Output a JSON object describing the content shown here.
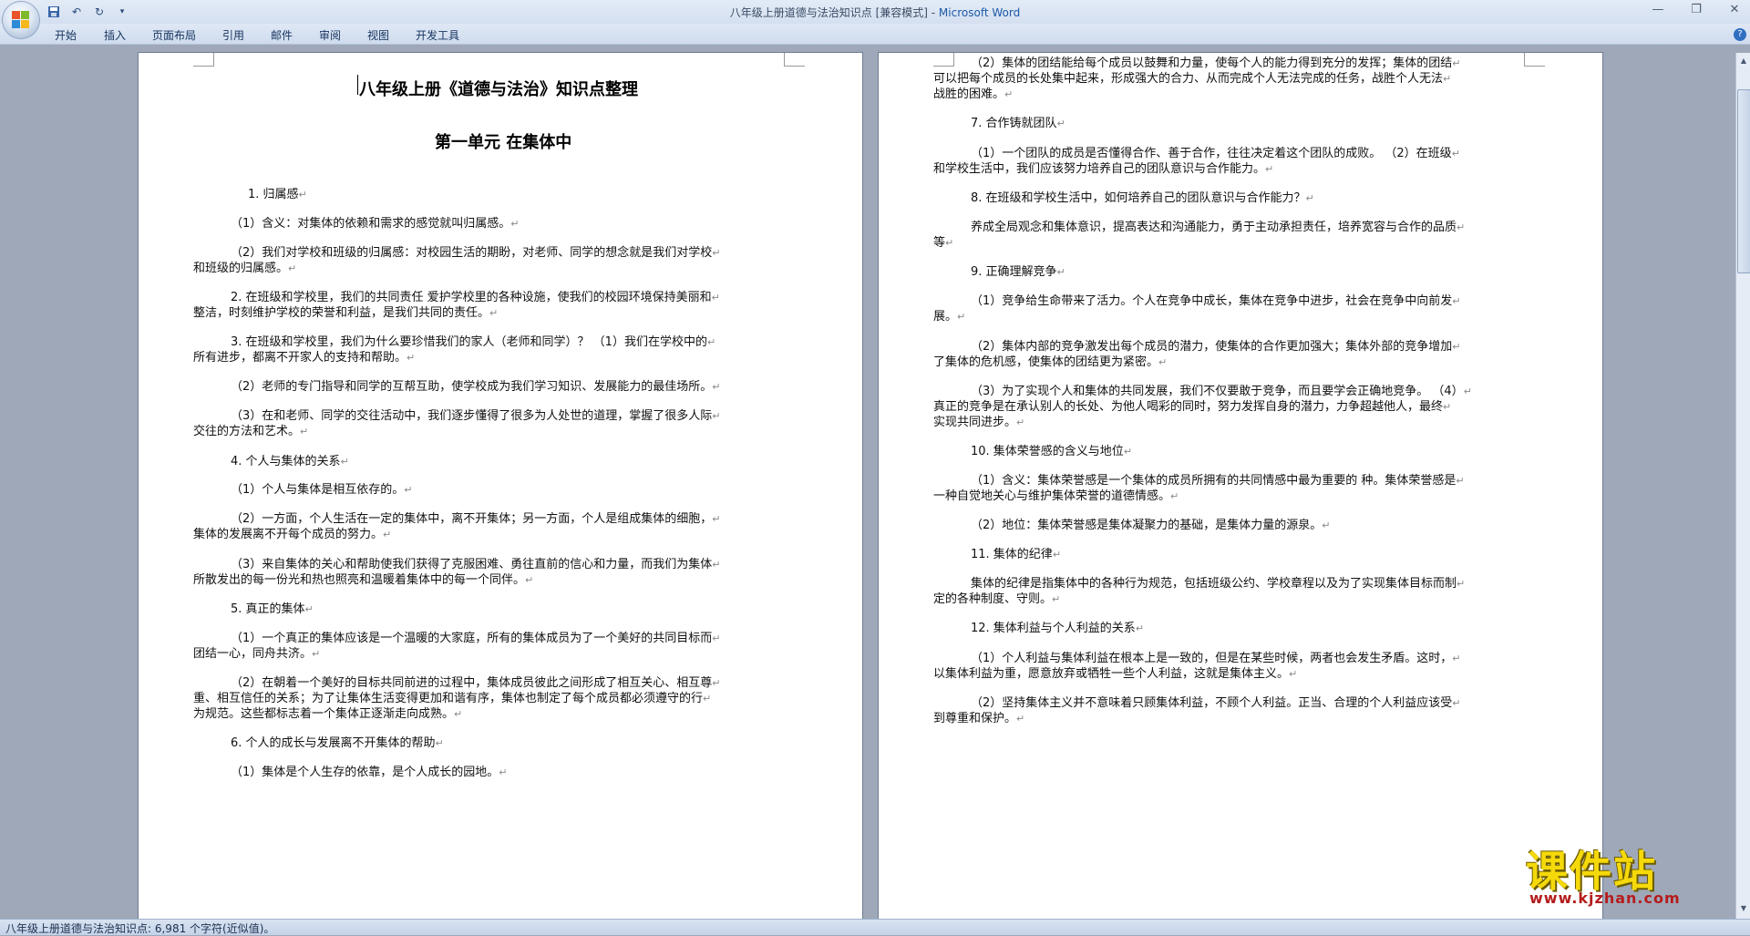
{
  "window": {
    "title": "八年级上册道德与法治知识点 [兼容模式] - ",
    "app": "Microsoft Word"
  },
  "qat": {
    "save_icon": "save-icon",
    "undo_icon": "undo-icon",
    "redo_icon": "redo-icon"
  },
  "ribbon": {
    "tabs": [
      "开始",
      "插入",
      "页面布局",
      "引用",
      "邮件",
      "审阅",
      "视图",
      "开发工具"
    ]
  },
  "status": {
    "text": "八年级上册道德与法治知识点: 6,981 个字符(近似值)。"
  },
  "watermark": {
    "text": "课件站",
    "url": "www.kjzhan.com"
  },
  "document": {
    "title": "八年级上册《道德与法治》知识点整理",
    "unit": "第一单元  在集体中",
    "left_lines": [
      "1. 归属感",
      "（1）含义：对集体的依赖和需求的感觉就叫归属感。",
      "（2）我们对学校和班级的归属感：对校园生活的期盼，对老师、同学的想念就是我们对学校",
      "和班级的归属感。",
      "2. 在班级和学校里，我们的共同责任  爱护学校里的各种设施，使我们的校园环境保持美丽和",
      "整洁，时刻维护学校的荣誉和利益，是我们共同的责任。",
      "3. 在班级和学校里，我们为什么要珍惜我们的家人（老师和同学）？  （1）我们在学校中的",
      "所有进步，都离不开家人的支持和帮助。",
      "（2）老师的专门指导和同学的互帮互助，使学校成为我们学习知识、发展能力的最佳场所。",
      "（3）在和老师、同学的交往活动中，我们逐步懂得了很多为人处世的道理，掌握了很多人际",
      "交往的方法和艺术。",
      "4. 个人与集体的关系",
      "（1）个人与集体是相互依存的。",
      "（2）一方面，个人生活在一定的集体中，离不开集体；另一方面，个人是组成集体的细胞，",
      "集体的发展离不开每个成员的努力。",
      "（3）来自集体的关心和帮助使我们获得了克服困难、勇往直前的信心和力量，而我们为集体",
      "所散发出的每一份光和热也照亮和温暖着集体中的每一个同伴。",
      "5. 真正的集体",
      "（1）一个真正的集体应该是一个温暖的大家庭，所有的集体成员为了一个美好的共同目标而",
      "团结一心，同舟共济。",
      "（2）在朝着一个美好的目标共同前进的过程中，集体成员彼此之间形成了相互关心、相互尊",
      "重、相互信任的关系；为了让集体生活变得更加和谐有序，集体也制定了每个成员都必须遵守的行",
      "为规范。这些都标志着一个集体正逐渐走向成熟。",
      "6. 个人的成长与发展离不开集体的帮助",
      "（1）集体是个人生存的依靠，是个人成长的园地。"
    ],
    "right_lines": [
      "（2）集体的团结能给每个成员以鼓舞和力量，使每个人的能力得到充分的发挥；集体的团结",
      "可以把每个成员的长处集中起来，形成强大的合力、从而完成个人无法完成的任务，战胜个人无法",
      "战胜的困难。",
      "7. 合作铸就团队",
      "（1）一个团队的成员是否懂得合作、善于合作，往往决定着这个团队的成败。  （2）在班级",
      "和学校生活中，我们应该努力培养自己的团队意识与合作能力。",
      "8. 在班级和学校生活中，如何培养自己的团队意识与合作能力？",
      "养成全局观念和集体意识，提高表达和沟通能力，勇于主动承担责任，培养宽容与合作的品质",
      "等",
      "9. 正确理解竞争",
      "（1）竞争给生命带来了活力。个人在竞争中成长，集体在竞争中进步，社会在竞争中向前发",
      "展。",
      "（2）集体内部的竞争激发出每个成员的潜力，使集体的合作更加强大；集体外部的竞争增加",
      "了集体的危机感，使集体的团结更为紧密。",
      "（3）为了实现个人和集体的共同发展，我们不仅要敢于竞争，而且要学会正确地竞争。  （4）",
      "真正的竞争是在承认别人的长处、为他人喝彩的同时，努力发挥自身的潜力，力争超越他人，最终",
      "实现共同进步。",
      "10. 集体荣誉感的含义与地位",
      "（1）含义：集体荣誉感是一个集体的成员所拥有的共同情感中最为重要的  种。集体荣誉感是",
      "一种自觉地关心与维护集体荣誉的道德情感。",
      "（2）地位：集体荣誉感是集体凝聚力的基础，是集体力量的源泉。",
      "11. 集体的纪律",
      "集体的纪律是指集体中的各种行为规范，包括班级公约、学校章程以及为了实现集体目标而制",
      "定的各种制度、守则。",
      "12. 集体利益与个人利益的关系",
      "（1）个人利益与集体利益在根本上是一致的，但是在某些时候，两者也会发生矛盾。这时，",
      "以集体利益为重，愿意放弃或牺牲一些个人利益，这就是集体主义。",
      "（2）坚持集体主义并不意味着只顾集体利益，不顾个人利益。正当、合理的个人利益应该受",
      "到尊重和保护。"
    ]
  }
}
